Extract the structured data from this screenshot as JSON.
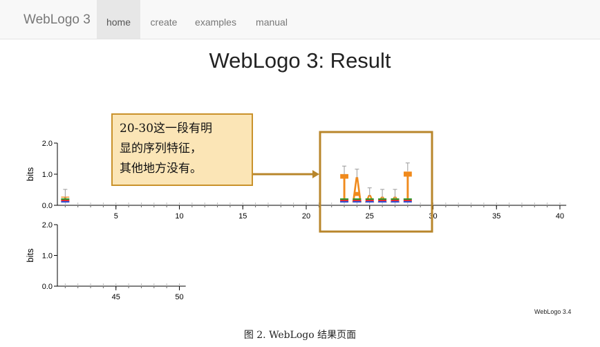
{
  "navbar": {
    "brand": "WebLogo 3",
    "links": [
      {
        "label": "home",
        "active": true
      },
      {
        "label": "create",
        "active": false
      },
      {
        "label": "examples",
        "active": false
      },
      {
        "label": "manual",
        "active": false
      }
    ]
  },
  "page_title": "WebLogo 3: Result",
  "annotation": {
    "lines": [
      "20-30这一段有明",
      "显的序列特征，",
      "其他地方没有。"
    ],
    "highlight_color": "#b8862b"
  },
  "chart_data": [
    {
      "type": "sequence-logo",
      "ylabel": "bits",
      "ylim": [
        0,
        2.0
      ],
      "yticks": [
        "0.0",
        "1.0",
        "2.0"
      ],
      "xlim": [
        1,
        40
      ],
      "xticks": [
        "5",
        "10",
        "15",
        "20",
        "25",
        "30",
        "35",
        "40"
      ],
      "letters": [
        {
          "pos": 1,
          "char": "T",
          "bits": 0.2,
          "color": "#f08a1c"
        },
        {
          "pos": 23,
          "char": "T",
          "bits": 0.95,
          "color": "#f08a1c"
        },
        {
          "pos": 24,
          "char": "A",
          "bits": 0.85,
          "color": "#f08a1c"
        },
        {
          "pos": 25,
          "char": "A",
          "bits": 0.25,
          "color": "#f08a1c"
        },
        {
          "pos": 26,
          "char": "A",
          "bits": 0.2,
          "color": "#f08a1c"
        },
        {
          "pos": 27,
          "char": "A",
          "bits": 0.2,
          "color": "#f08a1c"
        },
        {
          "pos": 28,
          "char": "T",
          "bits": 1.05,
          "color": "#f08a1c"
        }
      ],
      "minor_colors": [
        "#3250d8",
        "#e03030",
        "#2a9a2a"
      ]
    },
    {
      "type": "sequence-logo",
      "ylabel": "bits",
      "ylim": [
        0,
        2.0
      ],
      "yticks": [
        "0.0",
        "1.0",
        "2.0"
      ],
      "xlim": [
        41,
        50
      ],
      "xticks": [
        "45",
        "50"
      ]
    }
  ],
  "credit": "WebLogo 3.4",
  "caption": "图 2. WebLogo 结果页面"
}
